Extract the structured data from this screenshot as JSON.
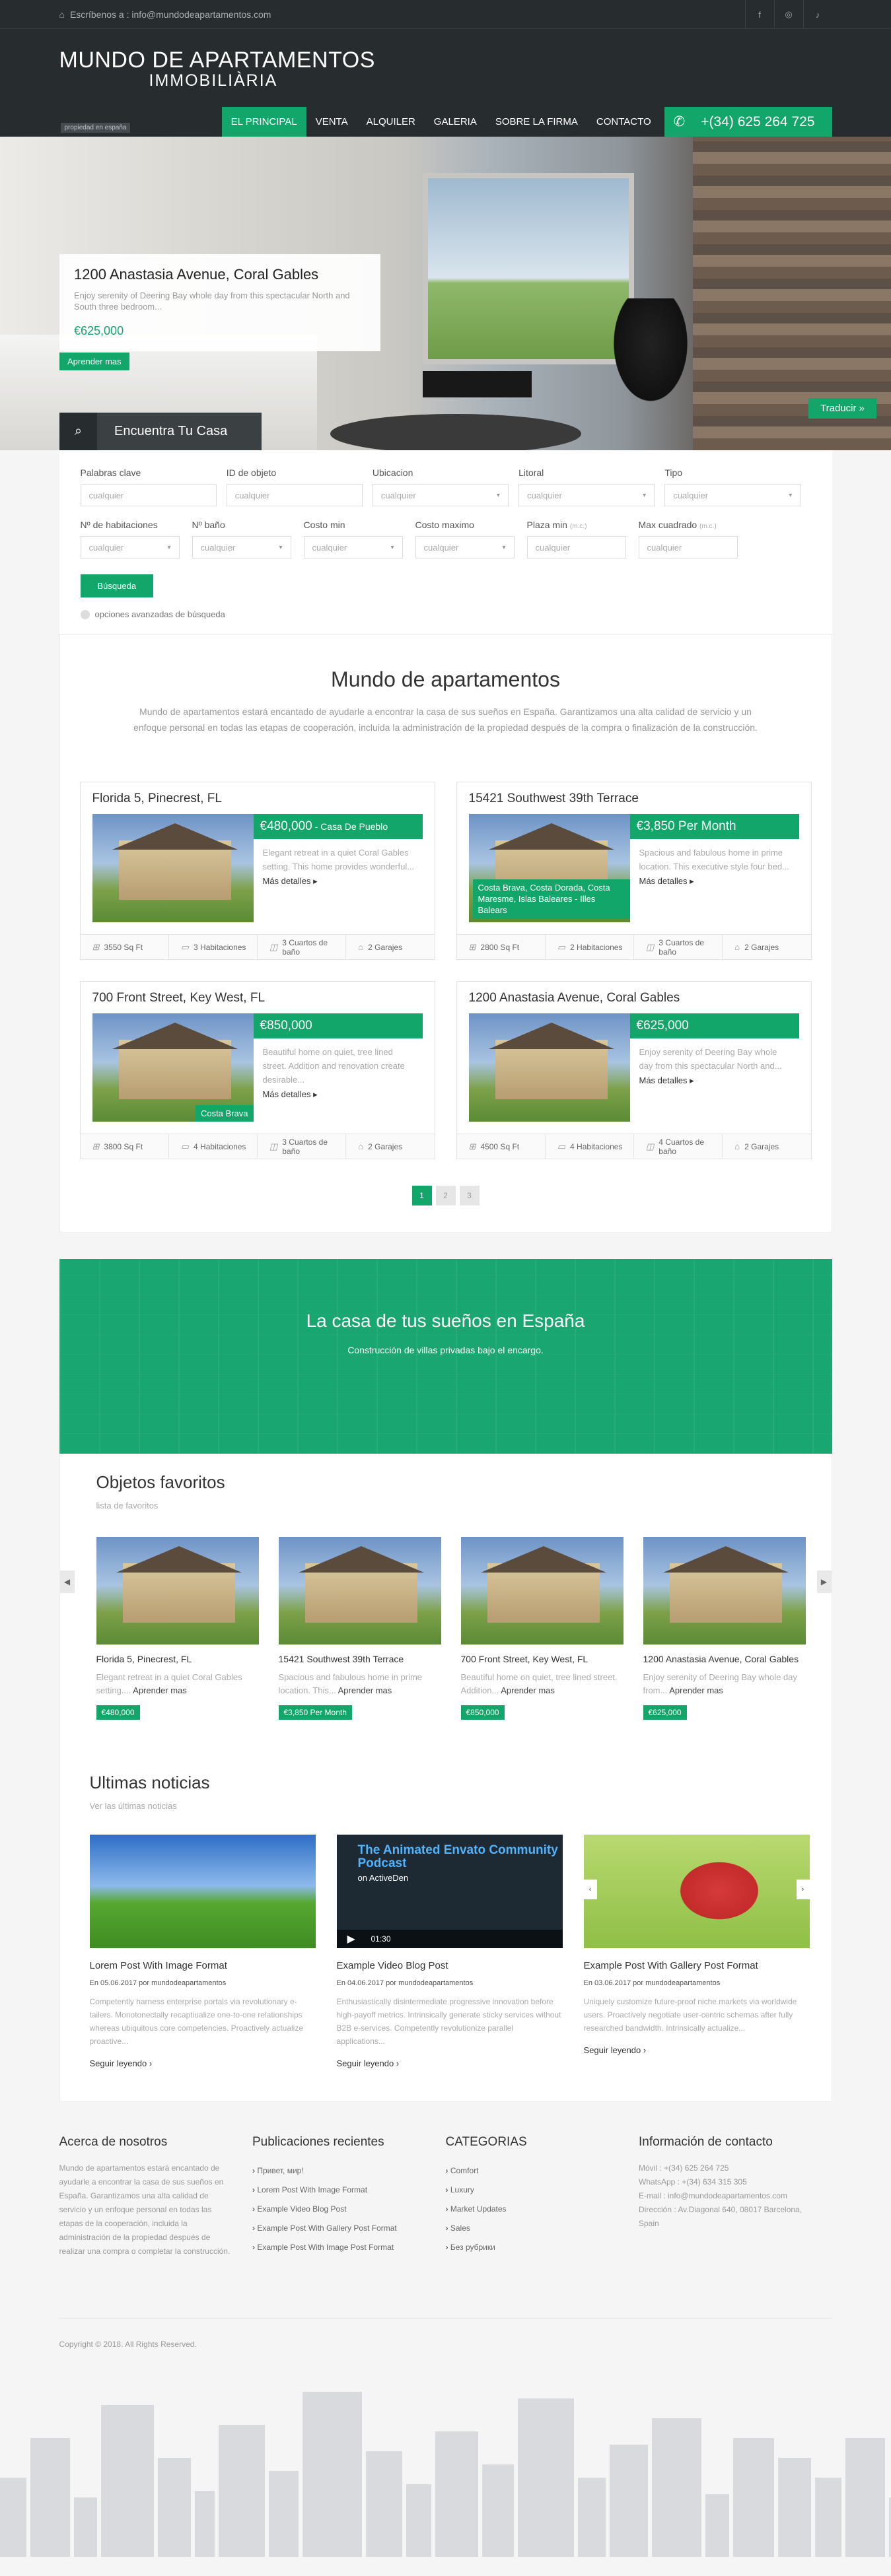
{
  "topbar": {
    "mail_label": "Escríbenos a : info@mundodeapartamentos.com",
    "social": [
      "f",
      "◎",
      "♪"
    ]
  },
  "brand": {
    "title": "MUNDO DE APARTAMENTOS",
    "subtitle": "IMMOBILIÀRIA",
    "tagline": "propiedad en españa"
  },
  "nav": {
    "items": [
      "EL PRINCIPAL",
      "VENTA",
      "ALQUILER",
      "GALERIA",
      "SOBRE LA FIRMA",
      "CONTACTO"
    ],
    "phone": "+(34) 625 264 725"
  },
  "hero": {
    "title": "1200 Anastasia Avenue, Coral Gables",
    "desc": "Enjoy serenity of Deering Bay whole day from this spectacular North and South  three bedroom...",
    "price": "€625,000",
    "learn_more": "Aprender mas",
    "translate": "Traducir »",
    "find": "Encuentra Tu Casa"
  },
  "search": {
    "labels": {
      "keywords": "Palabras clave",
      "object_id": "ID de objeto",
      "location": "Ubicacion",
      "coast": "Litoral",
      "type": "Tipo",
      "rooms": "Nº de habitaciones",
      "baths": "Nº baño",
      "min_cost": "Costo min",
      "max_cost": "Costo maximo",
      "min_area": "Plaza min",
      "max_area": "Max cuadrado",
      "unit": "(m.c.)"
    },
    "placeholder": "cualquier",
    "button": "Búsqueda",
    "advanced": "opciones avanzadas de búsqueda"
  },
  "intro": {
    "title": "Mundo de apartamentos",
    "text": "Mundo de apartamentos estará encantado de ayudarle a encontrar la casa de sus sueños en España. Garantizamos una alta calidad de servicio y un enfoque personal en todas las etapas de cooperación, incluida la administración de la propiedad después de la compra o finalización de la construcción."
  },
  "listings": [
    {
      "title": "Florida 5, Pinecrest, FL",
      "price": "€480,000",
      "price_note": " - Casa De Pueblo",
      "desc": "Elegant retreat in a quiet Coral Gables setting. This home provides wonderful...",
      "more": "Más detalles",
      "tag": "",
      "area": "3550 Sq Ft",
      "rooms": "3 Habitaciones",
      "baths": "3 Cuartos de baño",
      "garages": "2 Garajes"
    },
    {
      "title": "15421 Southwest 39th Terrace",
      "price": "€3,850 Per Month",
      "price_note": "",
      "desc": "Spacious and fabulous home in prime location. This executive style four bed...",
      "more": "Más detalles",
      "tag": "Costa Brava, Costa Dorada, Costa Maresme, Islas Baleares - Illes Balears",
      "area": "2800 Sq Ft",
      "rooms": "2 Habitaciones",
      "baths": "3 Cuartos de baño",
      "garages": "2 Garajes"
    },
    {
      "title": "700 Front Street, Key West, FL",
      "price": "€850,000",
      "price_note": "",
      "desc": "Beautiful home on quiet, tree lined street. Addition and renovation create desirable...",
      "more": "Más detalles",
      "tag": "Costa Brava",
      "area": "3800 Sq Ft",
      "rooms": "4 Habitaciones",
      "baths": "3 Cuartos de baño",
      "garages": "2 Garajes"
    },
    {
      "title": "1200 Anastasia Avenue, Coral Gables",
      "price": "€625,000",
      "price_note": "",
      "desc": "Enjoy serenity of Deering Bay whole day from this spectacular North and...",
      "more": "Más detalles",
      "tag": "",
      "area": "4500 Sq Ft",
      "rooms": "4 Habitaciones",
      "baths": "4 Cuartos de baño",
      "garages": "2 Garajes"
    }
  ],
  "pager": [
    "1",
    "2",
    "3"
  ],
  "banner": {
    "title": "La casa de tus sueños en España",
    "text": "Construcción de villas privadas bajo el encargo."
  },
  "favorites": {
    "title": "Objetos favoritos",
    "sub": "lista de favoritos",
    "learn": "Aprender mas",
    "items": [
      {
        "title": "Florida 5, Pinecrest, FL",
        "desc": "Elegant retreat in a quiet Coral Gables setting....",
        "price": "€480,000"
      },
      {
        "title": "15421 Southwest 39th Terrace",
        "desc": "Spacious and fabulous home in prime location. This...",
        "price": "€3,850 Per Month"
      },
      {
        "title": "700 Front Street, Key West, FL",
        "desc": "Beautiful home on quiet, tree lined street. Addition...",
        "price": "€850,000"
      },
      {
        "title": "1200 Anastasia Avenue, Coral Gables",
        "desc": "Enjoy serenity of Deering Bay whole day from...",
        "price": "€625,000"
      }
    ]
  },
  "news": {
    "title": "Ultimas noticias",
    "sub": "Ver las últimas noticias",
    "read_more": "Seguir leyendo",
    "video": {
      "title": "The Animated Envato Community Podcast",
      "sub": "on ActiveDen",
      "time": "01:30"
    },
    "posts": [
      {
        "title": "Lorem Post With Image Format",
        "meta": "En 05.06.2017 por mundodeapartamentos",
        "desc": "Competently harness enterprise portals via revolutionary e-tailers. Monotonectally recaptiualize one-to-one relationships whereas ubiquitous core competencies. Proactively actualize proactive..."
      },
      {
        "title": "Example Video Blog Post",
        "meta": "En 04.06.2017 por mundodeapartamentos",
        "desc": "Enthusiastically disintermediate progressive innovation before high-payoff metrics. Intrinsically generate sticky services without B2B e-services. Competently revolutionize parallel applications..."
      },
      {
        "title": "Example Post With Gallery Post Format",
        "meta": "En 03.06.2017 por mundodeapartamentos",
        "desc": "Uniquely customize future-proof niche markets via worldwide users. Proactively negotiate user-centric schemas after fully researched bandwidth. Intrinsically actualize..."
      }
    ]
  },
  "footer": {
    "about_title": "Acerca de nosotros",
    "about_text": "Mundo de apartamentos estará encantado de ayudarle a encontrar la casa de sus sueños en España. Garantizamos una alta calidad de servicio y un enfoque personal en todas las etapas de la cooperación, incluida la administración de la propiedad después de realizar una compra o completar la construcción.",
    "recent_title": "Publicaciones recientes",
    "recent": [
      "Привет, мир!",
      "Lorem Post With Image Format",
      "Example Video Blog Post",
      "Example Post With Gallery Post Format",
      "Example Post With Image Post Format"
    ],
    "cat_title": "CATEGORIAS",
    "cats": [
      "Comfort",
      "Luxury",
      "Market Updates",
      "Sales",
      "Без рубрики"
    ],
    "contact_title": "Información de contacto",
    "contact": [
      "Móvil : +(34) 625 264 725",
      "WhatsApp : +(34) 634 315 305",
      "E-mail : info@mundodeapartamentos.com",
      "Dirección : Av.Diagonal 640, 08017 Barcelona, Spain"
    ],
    "copyright": "Copyright © 2018. All Rights Reserved."
  },
  "colors": {
    "accent": "#13a66b",
    "dark": "#272c2f"
  }
}
